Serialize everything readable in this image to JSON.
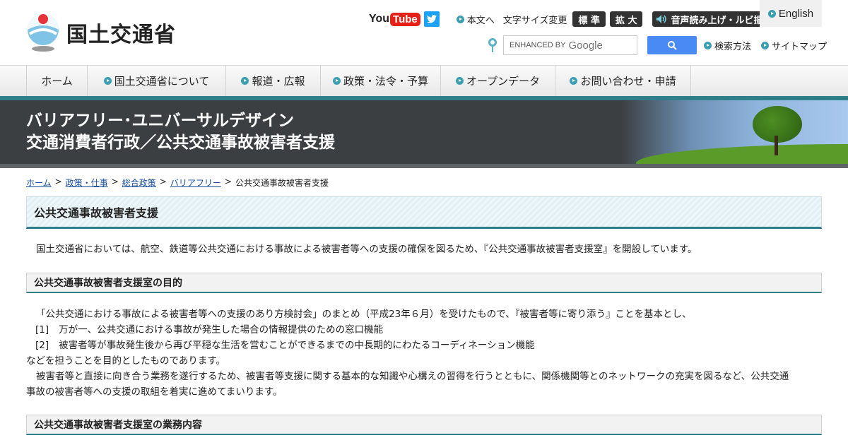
{
  "header": {
    "logo_text": "国土交通省",
    "youtube_you": "You",
    "youtube_tube": "Tube",
    "honbun_link": "本文へ",
    "font_size_label": "文字サイズ変更",
    "font_standard": "標 準",
    "font_large": "拡 大",
    "speech_button": "音声読み上げ・ルビ振り",
    "english_link": "English",
    "search_placeholder": "ENHANCED BY",
    "search_brand": "Google",
    "search_help": "検索方法",
    "sitemap": "サイトマップ"
  },
  "nav": {
    "items": [
      {
        "label": "ホーム"
      },
      {
        "label": "国土交通省について"
      },
      {
        "label": "報道・広報"
      },
      {
        "label": "政策・法令・予算"
      },
      {
        "label": "オープンデータ"
      },
      {
        "label": "お問い合わせ・申請"
      }
    ]
  },
  "banner": {
    "line1": "バリアフリー･ユニバーサルデザイン",
    "line2": "交通消費者行政／公共交通事故被害者支援"
  },
  "breadcrumb": {
    "items": [
      "ホーム",
      "政策・仕事",
      "総合政策",
      "バリアフリー"
    ],
    "current": "公共交通事故被害者支援",
    "separator": ">"
  },
  "content": {
    "title": "公共交通事故被害者支援",
    "intro": "国土交通省においては、航空、鉄道等公共交通における事故による被害者等への支援の確保を図るため、『公共交通事故被害者支援室』を開設しています。",
    "section1_title": "公共交通事故被害者支援室の目的",
    "section1_p1": "「公共交通における事故による被害者等への支援のあり方検討会」のまとめ（平成23年６月）を受けたもので、『被害者等に寄り添う』ことを基本とし、",
    "section1_list": [
      {
        "num": "[1]",
        "text": "万が一、公共交通における事故が発生した場合の情報提供のための窓口機能"
      },
      {
        "num": "[2]",
        "text": "被害者等が事故発生後から再び平穏な生活を営むことができるまでの中長期的にわたるコーディネーション機能"
      }
    ],
    "section1_p2": "などを担うことを目的としたものであります。",
    "section1_p3a": "被害者等と直接に向き合う業務を遂行するため、被害者等支援に関する基本的な知識や心構えの習得を行うとともに、関係機関等とのネットワークの充実を図るなど、公共交通",
    "section1_p3b": "事故の被害者等への支援の取組を着実に進めてまいります。",
    "section2_title": "公共交通事故被害者支援室の業務内容"
  }
}
